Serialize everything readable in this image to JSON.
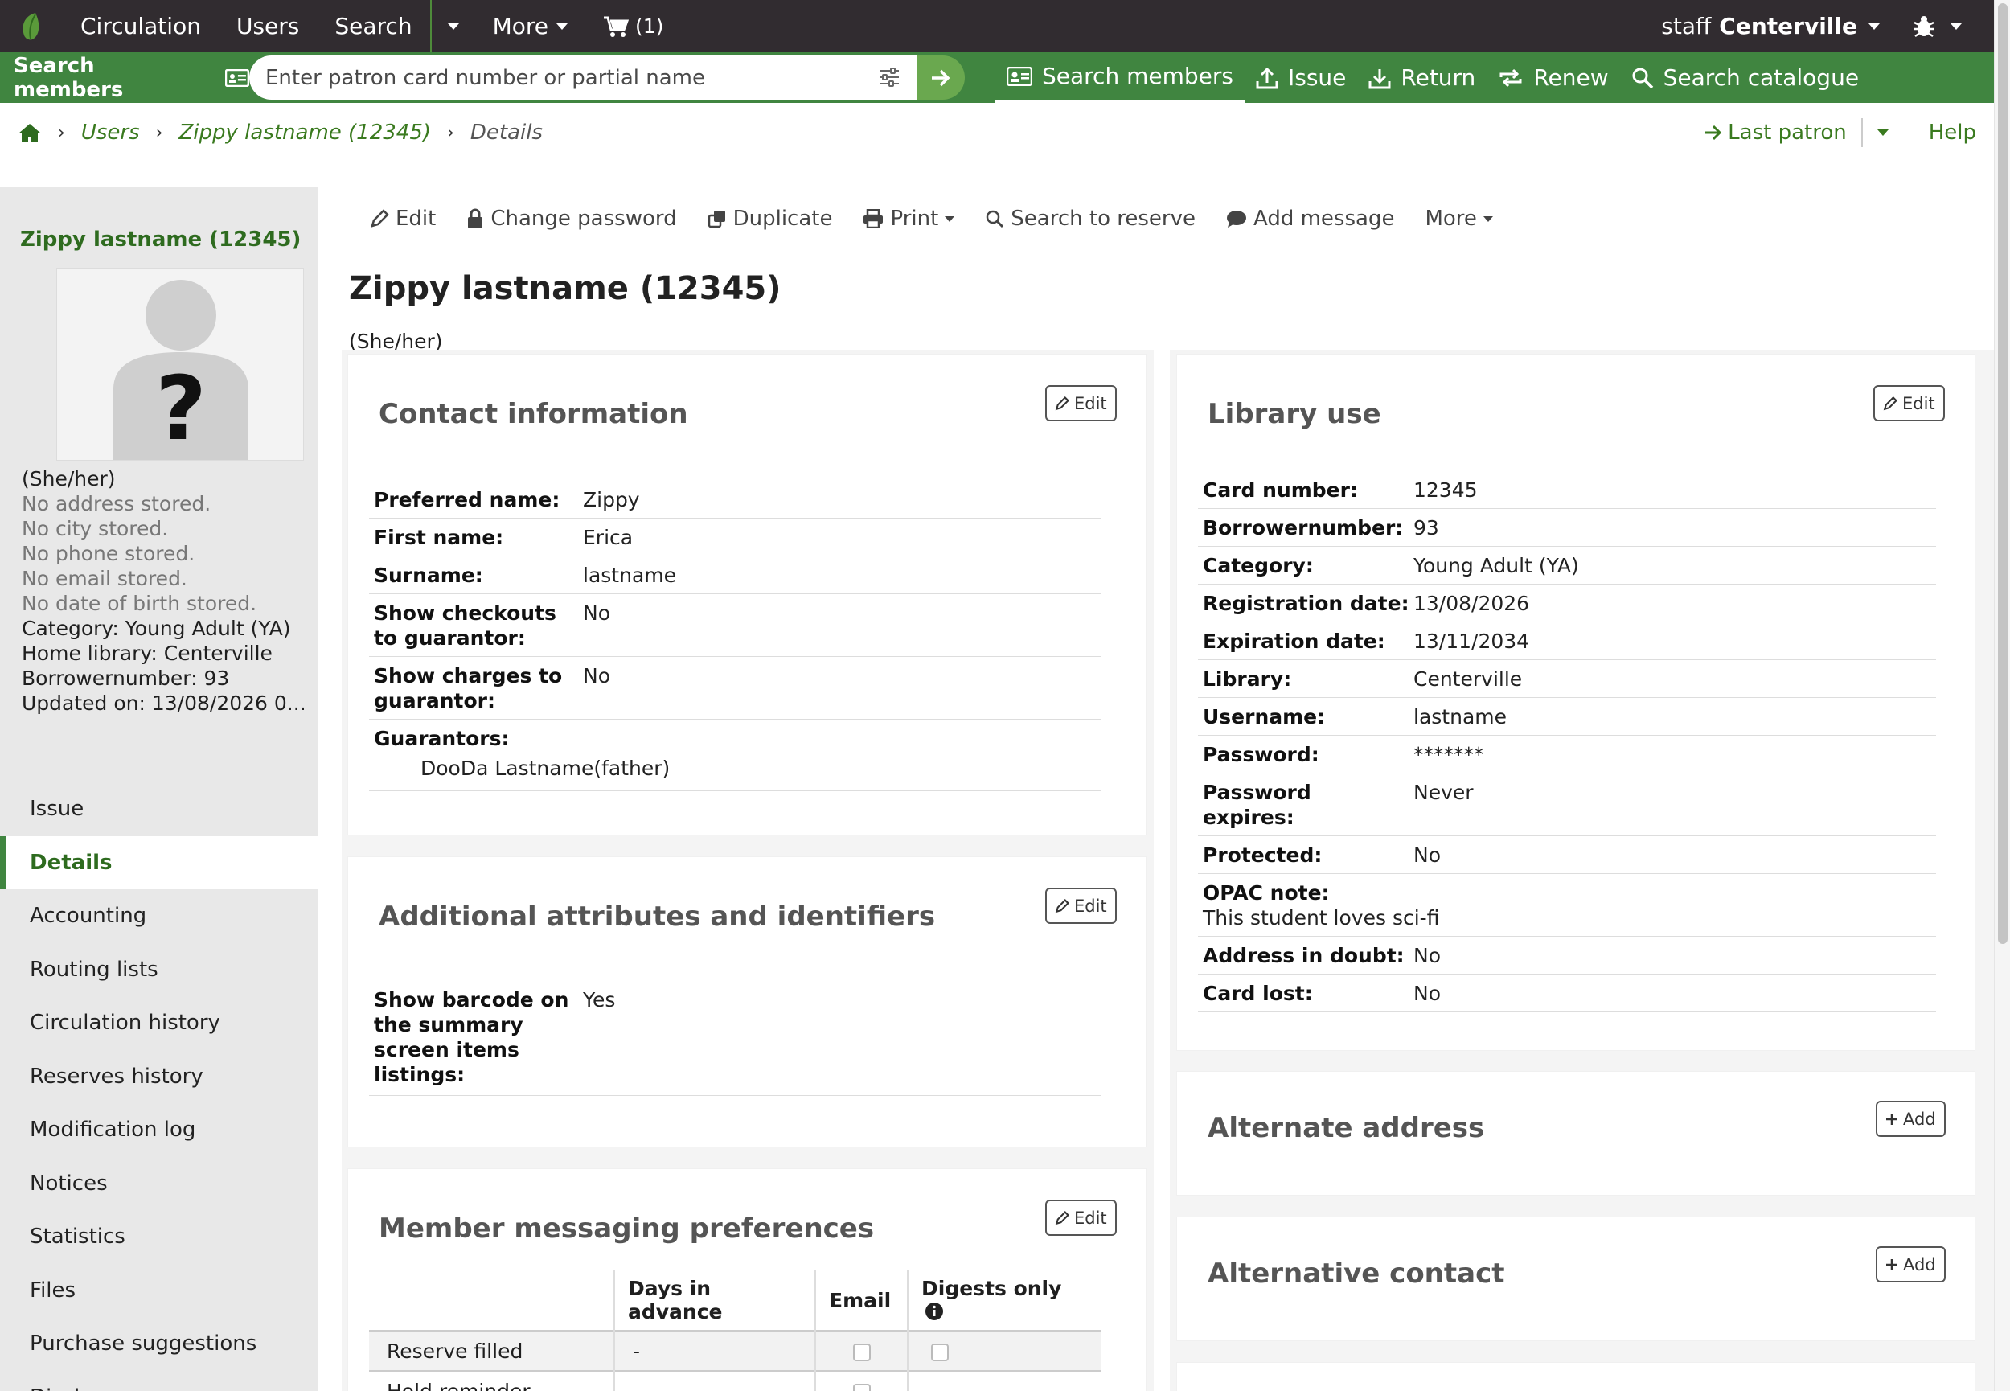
{
  "topnav": {
    "items": [
      "Circulation",
      "Users",
      "Search"
    ],
    "more": "More",
    "cart": "(1)",
    "staff_prefix": "staff",
    "staff_library": "Centerville"
  },
  "searchbar": {
    "label": "Search members",
    "placeholder": "Enter patron card number or partial name",
    "tools": [
      "Search members",
      "Issue",
      "Return",
      "Renew",
      "Search catalogue"
    ]
  },
  "breadcrumb": {
    "items": [
      "Users",
      "Zippy lastname (12345)"
    ],
    "current": "Details"
  },
  "top_links": {
    "last_patron": "Last patron",
    "help": "Help"
  },
  "sidebar": {
    "patron_name": "Zippy lastname (12345)",
    "pronouns": "(She/her)",
    "no_address": "No address stored.",
    "no_city": "No city stored.",
    "no_phone": "No phone stored.",
    "no_email": "No email stored.",
    "no_dob": "No date of birth stored.",
    "category": "Category: Young Adult (YA)",
    "home_library": "Home library: Centerville",
    "borrowernumber": "Borrowernumber: 93",
    "updated": "Updated on: 13/08/2026 0...",
    "menu": [
      "Issue",
      "Details",
      "Accounting",
      "Routing lists",
      "Circulation history",
      "Reserves history",
      "Modification log",
      "Notices",
      "Statistics",
      "Files",
      "Purchase suggestions",
      "Discharges"
    ]
  },
  "toolbar": {
    "edit": "Edit",
    "change_password": "Change password",
    "duplicate": "Duplicate",
    "print": "Print",
    "search_to_reserve": "Search to reserve",
    "add_message": "Add message",
    "more": "More"
  },
  "main": {
    "title": "Zippy lastname (12345)",
    "pronouns": "(She/her)"
  },
  "contact": {
    "title": "Contact information",
    "edit": "Edit",
    "preferred_name_k": "Preferred name:",
    "preferred_name_v": "Zippy",
    "first_name_k": "First name:",
    "first_name_v": "Erica",
    "surname_k": "Surname:",
    "surname_v": "lastname",
    "show_checkouts_k1": "Show checkouts",
    "show_checkouts_k2": "to guarantor:",
    "show_checkouts_v": "No",
    "show_charges_k1": "Show charges to",
    "show_charges_k2": "guarantor:",
    "show_charges_v": "No",
    "guarantors_k": "Guarantors:",
    "guarantors_v": "DooDa Lastname(father)"
  },
  "attributes": {
    "title": "Additional attributes and identifiers",
    "edit": "Edit",
    "barcode_k1": "Show barcode on",
    "barcode_k2": "the summary",
    "barcode_k3": "screen items",
    "barcode_k4": "listings:",
    "barcode_v": "Yes"
  },
  "messaging": {
    "title": "Member messaging preferences",
    "edit": "Edit",
    "col_days": "Days in advance",
    "col_email": "Email",
    "col_digests": "Digests only",
    "row1": "Reserve filled",
    "row1_days": "-",
    "row2": "Hold reminder",
    "row2_days": "-",
    "row2_digest": "-"
  },
  "library_use": {
    "title": "Library use",
    "edit": "Edit",
    "card_k": "Card number:",
    "card_v": "12345",
    "borr_k": "Borrowernumber:",
    "borr_v": "93",
    "cat_k": "Category:",
    "cat_v": "Young Adult (YA)",
    "reg_k": "Registration date:",
    "reg_v": "13/08/2026",
    "exp_k": "Expiration date:",
    "exp_v": "13/11/2034",
    "lib_k": "Library:",
    "lib_v": "Centerville",
    "user_k": "Username:",
    "user_v": "lastname",
    "pw_k": "Password:",
    "pw_v": "*******",
    "pwexp_k1": "Password",
    "pwexp_k2": "expires:",
    "pwexp_v": "Never",
    "prot_k": "Protected:",
    "prot_v": "No",
    "opac_k": "OPAC note:",
    "opac_v": "This student loves sci-fi",
    "doubt_k": "Address in doubt:",
    "doubt_v": "No",
    "lost_k": "Card lost:",
    "lost_v": "No"
  },
  "alternate_address": {
    "title": "Alternate address",
    "add": "Add"
  },
  "alternative_contact": {
    "title": "Alternative contact",
    "add": "Add"
  }
}
